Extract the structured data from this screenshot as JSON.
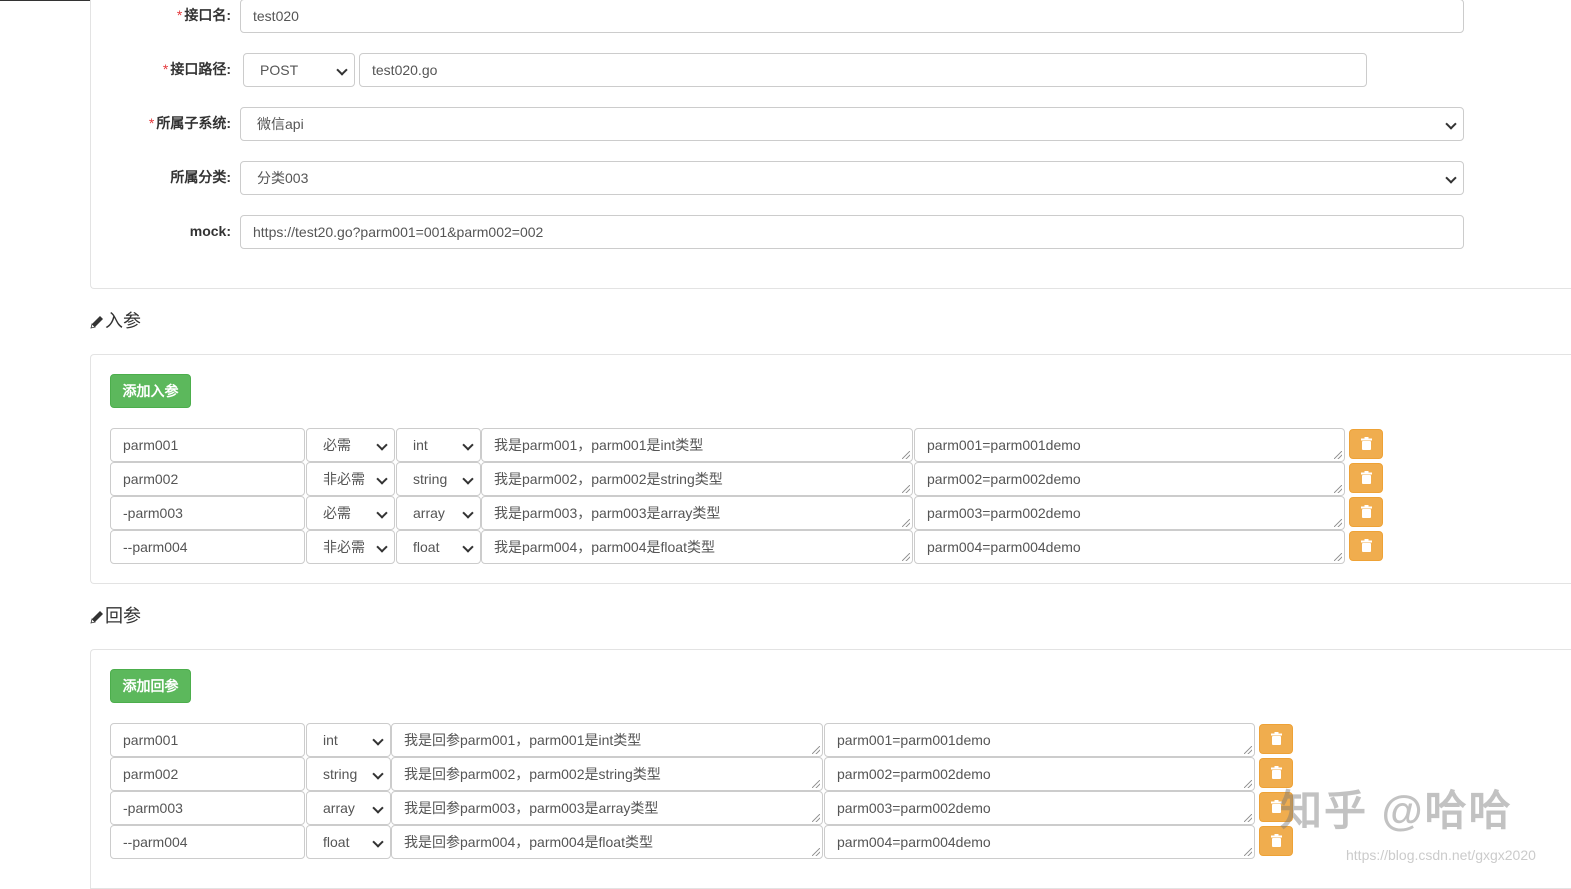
{
  "form": {
    "api_name": {
      "label": "接口名:",
      "value": "test020"
    },
    "api_path": {
      "label": "接口路径:",
      "method": "POST",
      "value": "test020.go"
    },
    "subsystem": {
      "label": "所属子系统:",
      "value": "微信api"
    },
    "category": {
      "label": "所属分类:",
      "value": "分类003"
    },
    "mock": {
      "label": "mock:",
      "value": "https://test20.go?parm001=001&parm002=002"
    }
  },
  "input_params": {
    "title": "入参",
    "add_label": "添加入参",
    "rows": [
      {
        "name": "parm001",
        "required": "必需",
        "type": "int",
        "desc": "我是parm001，parm001是int类型",
        "example": "parm001=parm001demo"
      },
      {
        "name": "parm002",
        "required": "非必需",
        "type": "string",
        "desc": "我是parm002，parm002是string类型",
        "example": "parm002=parm002demo"
      },
      {
        "name": "-parm003",
        "required": "必需",
        "type": "array",
        "desc": "我是parm003，parm003是array类型",
        "example": "parm003=parm002demo"
      },
      {
        "name": "--parm004",
        "required": "非必需",
        "type": "float",
        "desc": "我是parm004，parm004是float类型",
        "example": "parm004=parm004demo"
      }
    ]
  },
  "output_params": {
    "title": "回参",
    "add_label": "添加回参",
    "rows": [
      {
        "name": "parm001",
        "type": "int",
        "desc": "我是回参parm001，parm001是int类型",
        "example": "parm001=parm001demo"
      },
      {
        "name": "parm002",
        "type": "string",
        "desc": "我是回参parm002，parm002是string类型",
        "example": "parm002=parm002demo"
      },
      {
        "name": "-parm003",
        "type": "array",
        "desc": "我是回参parm003，parm003是array类型",
        "example": "parm003=parm002demo"
      },
      {
        "name": "--parm004",
        "type": "float",
        "desc": "我是回参parm004，parm004是float类型",
        "example": "parm004=parm004demo"
      }
    ]
  },
  "watermark": {
    "main": "知乎 @哈哈",
    "url": "https://blog.csdn.net/gxgx2020"
  },
  "icons": {
    "section": "pencil-icon",
    "delete": "trash-icon",
    "select": "chevron-down-icon"
  },
  "colors": {
    "add_button": "#5cb85c",
    "delete_button": "#f0ad4e",
    "required_star": "#e4393c"
  }
}
